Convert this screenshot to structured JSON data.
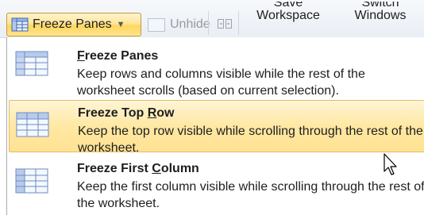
{
  "ribbon": {
    "freeze_panes_label": "Freeze Panes",
    "unhide_label": "Unhide",
    "save_workspace_l1": "Save",
    "save_workspace_l2": "Workspace",
    "switch_windows_l1": "Switch",
    "switch_windows_l2": "Windows"
  },
  "menu": {
    "items": [
      {
        "title": "Freeze Panes",
        "mnemonic_char": "F",
        "description": "Keep rows and columns visible while the rest of the worksheet scrolls (based on current selection).",
        "icon": "freeze-panes-icon"
      },
      {
        "title": "Freeze Top Row",
        "mnemonic_char": "R",
        "description": "Keep the top row visible while scrolling through the rest of the worksheet.",
        "icon": "freeze-top-row-icon",
        "selected": true
      },
      {
        "title": "Freeze First Column",
        "mnemonic_char": "C",
        "description": "Keep the first column visible while scrolling through the rest of the worksheet.",
        "icon": "freeze-first-column-icon"
      }
    ]
  },
  "colors": {
    "highlight": "#ffe8a3",
    "highlight_border": "#e3bd5d",
    "grid_icon_blue": "#6b8cc4"
  }
}
